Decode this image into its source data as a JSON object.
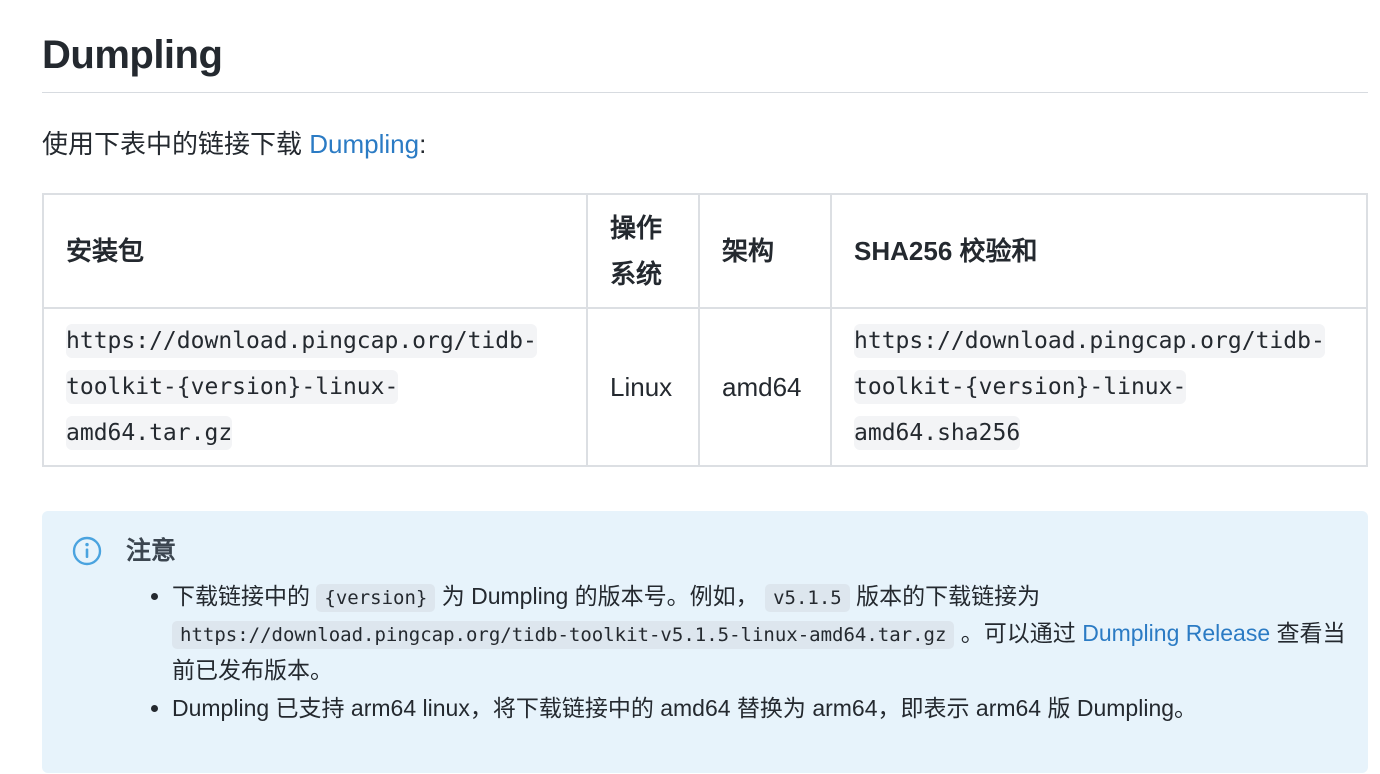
{
  "heading": "Dumpling",
  "intro": {
    "prefix": "使用下表中的链接下载 ",
    "link": "Dumpling",
    "suffix": ":"
  },
  "table": {
    "headers": [
      "安装包",
      "操作系统",
      "架构",
      "SHA256 校验和"
    ],
    "row": {
      "package": "https://download.pingcap.org/tidb-toolkit-{version}-linux-amd64.tar.gz",
      "os": "Linux",
      "arch": "amd64",
      "checksum": "https://download.pingcap.org/tidb-toolkit-{version}-linux-amd64.sha256"
    }
  },
  "note": {
    "icon": "info-circle-icon",
    "title": "注意",
    "item1": {
      "t1": "下载链接中的 ",
      "code1": "{version}",
      "t2": " 为 Dumpling 的版本号。例如， ",
      "code2": "v5.1.5",
      "t3": " 版本的下载链接为 ",
      "code3": "https://download.pingcap.org/tidb-toolkit-v5.1.5-linux-amd64.tar.gz",
      "t4": " 。可以通过 ",
      "link": "Dumpling Release",
      "t5": " 查看当前已发布版本。"
    },
    "item2": "Dumpling 已支持 arm64 linux，将下载链接中的 amd64 替换为 arm64，即表示 arm64 版 Dumpling。"
  },
  "colors": {
    "link": "#2b7bc4",
    "callout_bg": "#e7f3fb",
    "info_icon": "#4aa3df",
    "table_border": "#dcdfe3"
  }
}
